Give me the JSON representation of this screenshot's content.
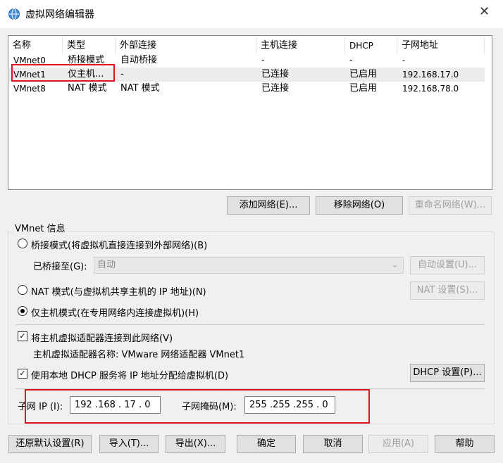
{
  "window": {
    "title": "虚拟网络编辑器",
    "icon": "globe-icon"
  },
  "table": {
    "headers": [
      "名称",
      "类型",
      "外部连接",
      "主机连接",
      "DHCP",
      "子网地址"
    ],
    "rows": [
      [
        "VMnet0",
        "桥接模式",
        "自动桥接",
        "-",
        "-",
        "-"
      ],
      [
        "VMnet1",
        "仅主机...",
        "-",
        "已连接",
        "已启用",
        "192.168.17.0"
      ],
      [
        "VMnet8",
        "NAT 模式",
        "NAT 模式",
        "已连接",
        "已启用",
        "192.168.78.0"
      ]
    ],
    "selected_row": 1
  },
  "list_buttons": {
    "add": "添加网络(E)...",
    "remove": "移除网络(O)",
    "rename": "重命名网络(W)..."
  },
  "info": {
    "legend": "VMnet 信息",
    "bridged_radio": "桥接模式(将虚拟机直接连接到外部网络)(B)",
    "bridged_to_label": "已桥接至(G):",
    "bridged_to_value": "自动",
    "auto_settings": "自动设置(U)...",
    "nat_radio": "NAT 模式(与虚拟机共享主机的 IP 地址)(N)",
    "nat_settings": "NAT 设置(S)...",
    "hostonly_radio": "仅主机模式(在专用网络内连接虚拟机)(H)",
    "selected_mode": "hostonly",
    "connect_adapter_check": "将主机虚拟适配器连接到此网络(V)",
    "connect_adapter_checked": true,
    "adapter_name": "主机虚拟适配器名称: VMware 网络适配器 VMnet1",
    "dhcp_check": "使用本地 DHCP 服务将 IP 地址分配给虚拟机(D)",
    "dhcp_checked": true,
    "dhcp_settings": "DHCP 设置(P)...",
    "subnet_ip_label": "子网 IP (I):",
    "subnet_ip": "192 .168 . 17 . 0",
    "subnet_mask_label": "子网掩码(M):",
    "subnet_mask": "255 .255 .255 . 0"
  },
  "footer": {
    "restore": "还原默认设置(R)",
    "import": "导入(T)...",
    "export": "导出(X)...",
    "ok": "确定",
    "cancel": "取消",
    "apply": "应用(A)",
    "help": "帮助"
  },
  "highlight_color": "#e0141e"
}
